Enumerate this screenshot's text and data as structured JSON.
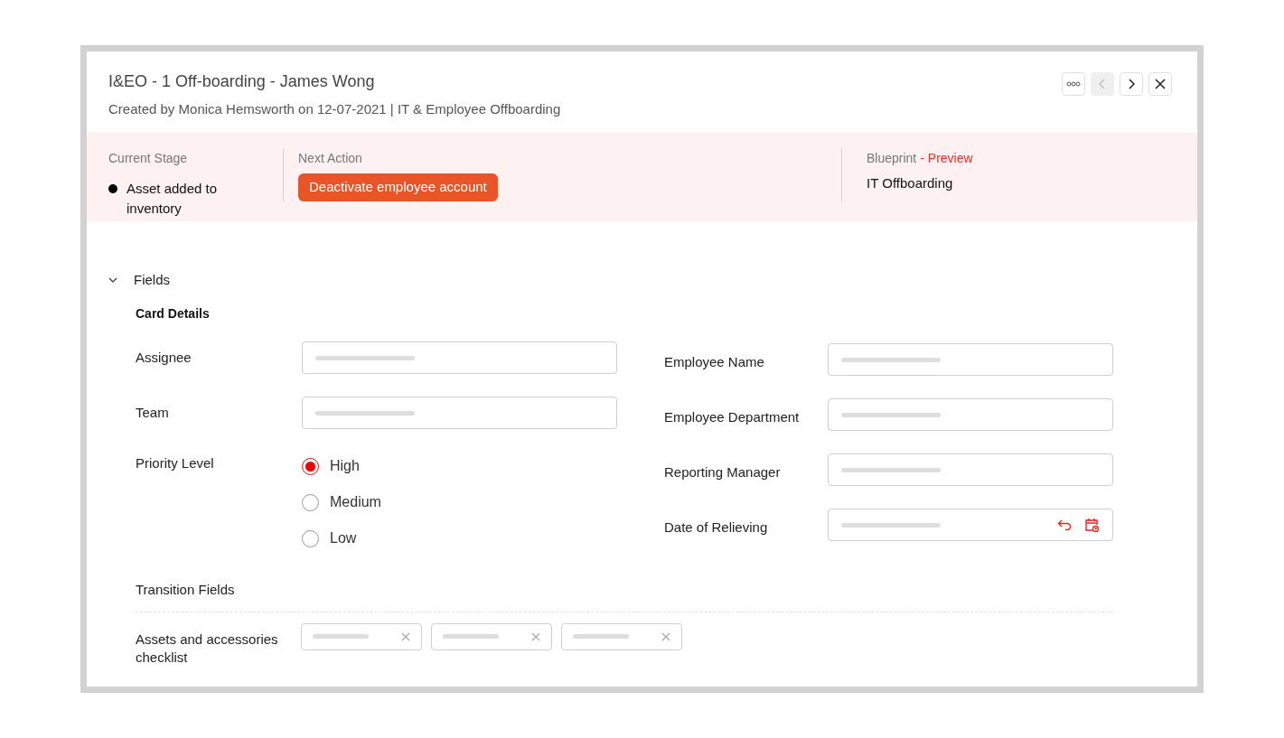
{
  "header": {
    "title": "I&EO - 1 Off-boarding - James Wong",
    "subtitle": "Created by Monica Hemsworth on 12-07-2021 | IT & Employee Offboarding"
  },
  "toolbar": [
    {
      "kind": "more",
      "disabled": false
    },
    {
      "kind": "prev",
      "disabled": true
    },
    {
      "kind": "next",
      "disabled": false
    },
    {
      "kind": "close",
      "disabled": false
    }
  ],
  "stage_bar": {
    "current_stage": {
      "label": "Current Stage",
      "value": "Asset added to inventory"
    },
    "next_action": {
      "label": "Next Action",
      "button": "Deactivate employee account"
    },
    "blueprint": {
      "label": "Blueprint",
      "link": "- Preview",
      "value": "IT Offboarding"
    }
  },
  "fields_section": {
    "title": "Fields",
    "expanded": true,
    "subtitle": "Card Details",
    "left": [
      {
        "kind": "text",
        "label": "Assignee"
      },
      {
        "kind": "text",
        "label": "Team"
      },
      {
        "kind": "radio",
        "label": "Priority Level",
        "options": [
          {
            "label": "High",
            "selected": true
          },
          {
            "label": "Medium",
            "selected": false
          },
          {
            "label": "Low",
            "selected": false
          }
        ]
      }
    ],
    "right": [
      {
        "kind": "text",
        "label": "Employee Name"
      },
      {
        "kind": "text",
        "label": "Employee Department"
      },
      {
        "kind": "text",
        "label": "Reporting Manager"
      },
      {
        "kind": "date",
        "label": "Date of Relieving"
      }
    ]
  },
  "transition": {
    "title": "Transition Fields",
    "label": "Assets and accessories checklist",
    "chips": [
      {
        "removable": true
      },
      {
        "removable": true
      },
      {
        "removable": true
      }
    ]
  }
}
